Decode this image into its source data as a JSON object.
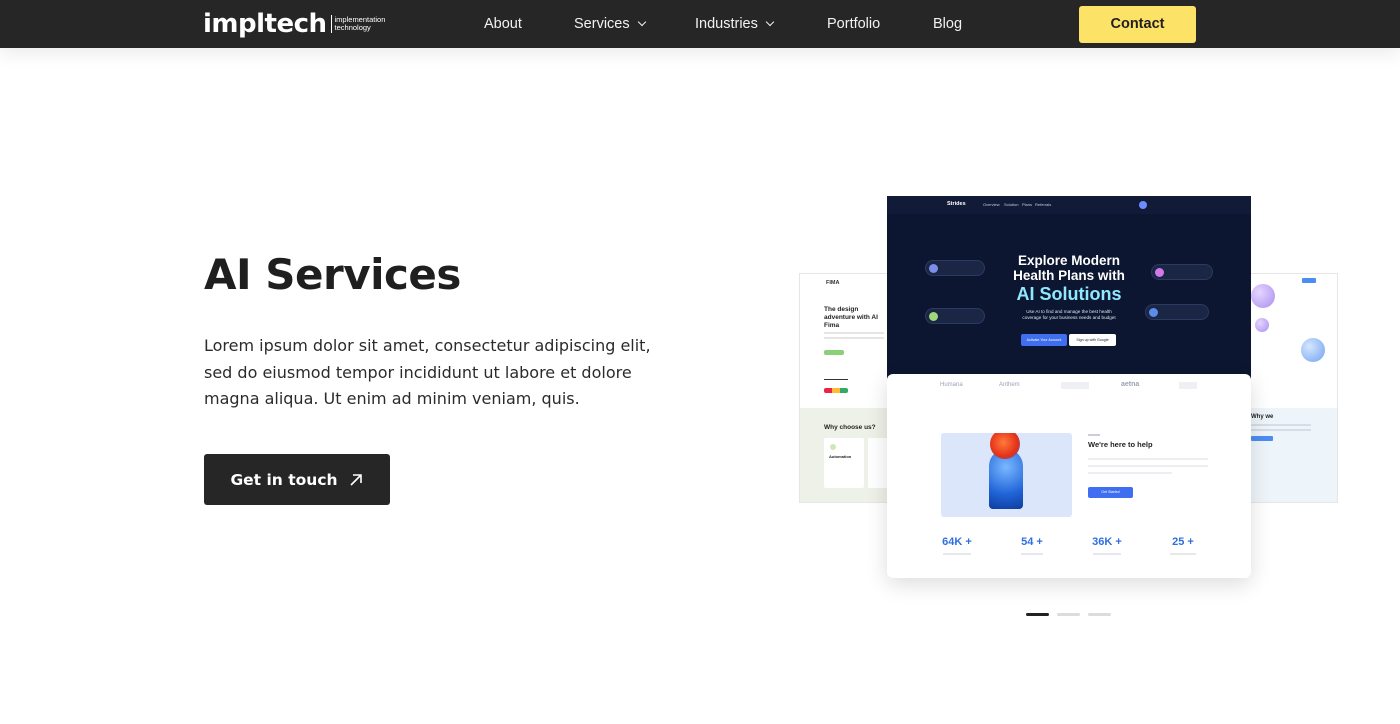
{
  "header": {
    "logo": {
      "main": "impltech",
      "sub_line1": "implementation",
      "sub_line2": "technology"
    },
    "nav": [
      {
        "label": "About",
        "has_dropdown": false
      },
      {
        "label": "Services",
        "has_dropdown": true
      },
      {
        "label": "Industries",
        "has_dropdown": true
      },
      {
        "label": "Portfolio",
        "has_dropdown": false
      },
      {
        "label": "Blog",
        "has_dropdown": false
      }
    ],
    "contact_label": "Contact"
  },
  "hero": {
    "title": "AI Services",
    "description": "Lorem ipsum dolor sit amet, consectetur adipiscing elit, sed do eiusmod tempor incididunt ut labore et dolore magna aliqua. Ut enim ad minim veniam, quis.",
    "cta_label": "Get in touch",
    "cta_icon": "arrow-up-right-icon"
  },
  "mockups": {
    "left": {
      "brand": "FIMA",
      "headline": "The design adventure with AI Fima",
      "section": "Why choose us?",
      "item": "Automation"
    },
    "top": {
      "brand": "Strides",
      "nav": [
        "Overview",
        "Solution",
        "Plans",
        "Referrals"
      ],
      "heading_line1": "Explore Modern",
      "heading_line2": "Health Plans with",
      "heading_highlight": "AI Solutions",
      "sub_line1": "Use AI to find and manage the best health",
      "sub_line2": "coverage for your business needs and budget",
      "btn_primary": "Activate Your Account",
      "btn_secondary": "Sign up with Google"
    },
    "bottom": {
      "partners": [
        "Humana",
        "Anthem",
        "aetna"
      ],
      "help_title": "We're here to help",
      "help_button": "Get Started",
      "stats": [
        {
          "value": "64K +"
        },
        {
          "value": "54 +"
        },
        {
          "value": "36K +"
        },
        {
          "value": "25 +"
        }
      ]
    },
    "right": {
      "heading": "Why we"
    }
  },
  "carousel": {
    "slides": 3,
    "active": 1
  },
  "colors": {
    "nav_bg": "#262626",
    "accent_yellow": "#fde268",
    "stat_blue": "#2f6fe0",
    "mockup_dark": "#0d1630"
  }
}
